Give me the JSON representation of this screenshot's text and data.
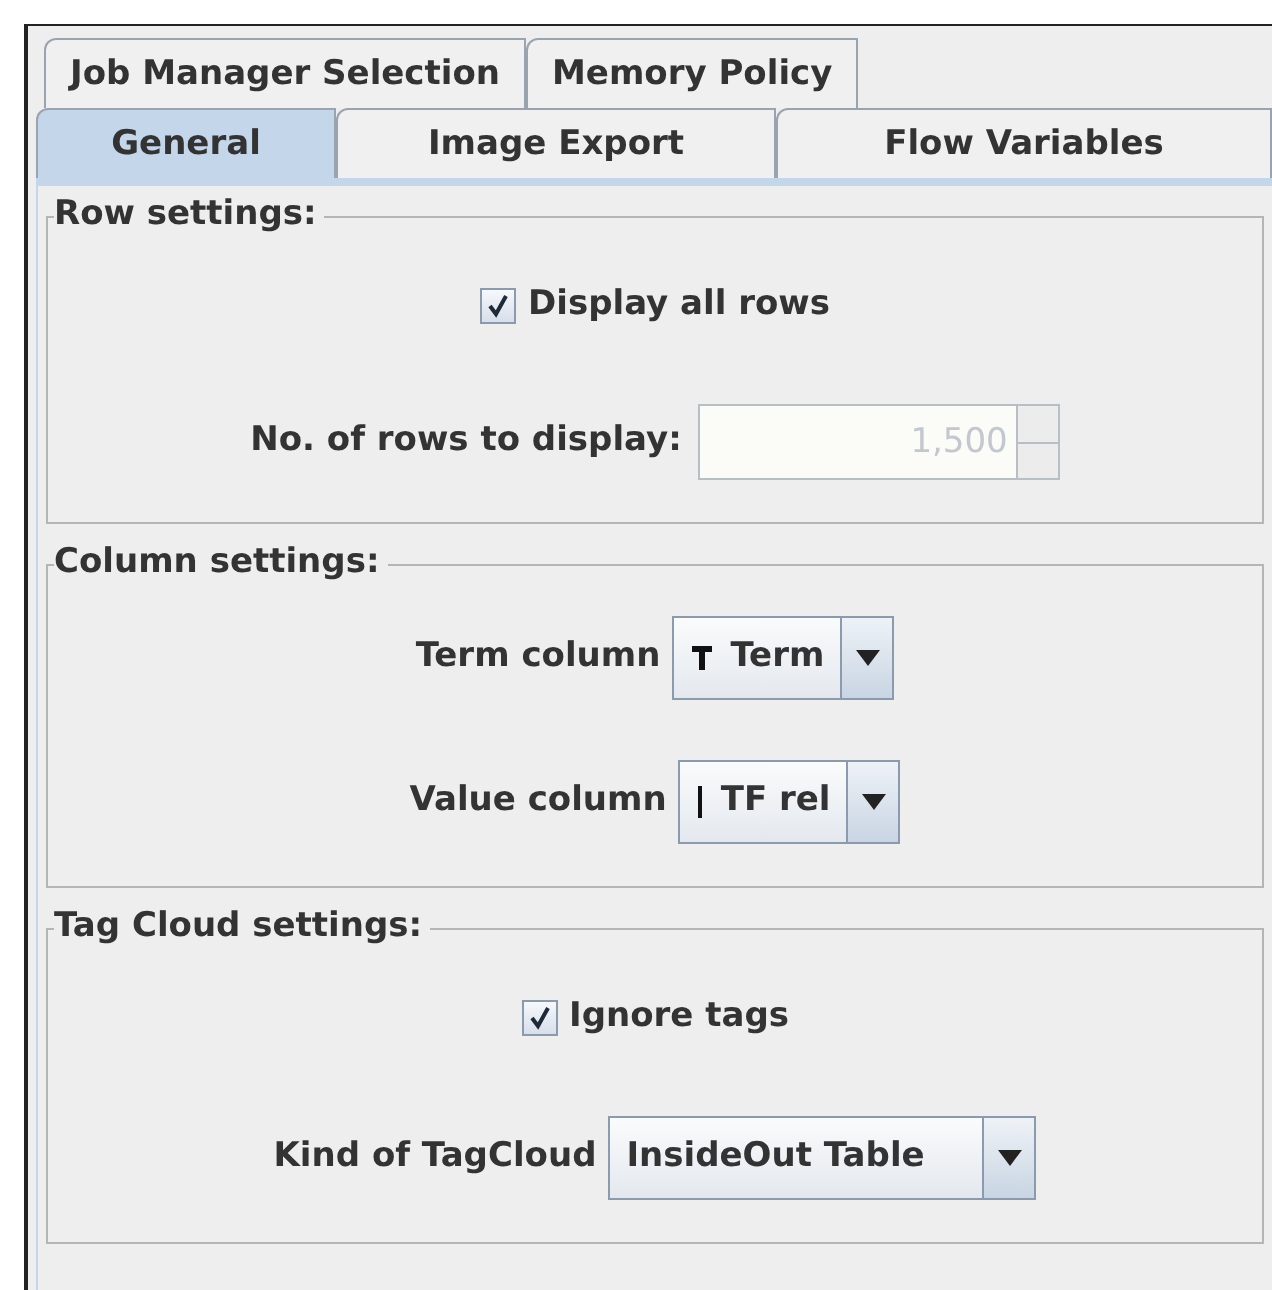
{
  "tab_rows": [
    [
      {
        "label": "Job Manager Selection",
        "selected": false
      },
      {
        "label": "Memory Policy",
        "selected": false
      }
    ],
    [
      {
        "label": "General",
        "selected": true
      },
      {
        "label": "Image Export",
        "selected": false
      },
      {
        "label": "Flow Variables",
        "selected": false
      }
    ]
  ],
  "sections": [
    {
      "title": "Row settings:",
      "rows": [
        {
          "kind": "checkbox",
          "label": "Display all rows",
          "checked": true
        },
        {
          "kind": "spinner",
          "label": "No. of rows to display:",
          "value": "1,500",
          "disabled": true
        }
      ]
    },
    {
      "title": "Column settings:",
      "rows": [
        {
          "kind": "combo",
          "label": "Term column",
          "value": "Term",
          "type_icon": {
            "kind": "string"
          }
        },
        {
          "kind": "combo",
          "label": "Value column",
          "value": "TF rel",
          "type_icon": {
            "kind": "double"
          }
        }
      ]
    },
    {
      "title": "Tag Cloud settings:",
      "rows": [
        {
          "kind": "checkbox",
          "label": "Ignore tags",
          "checked": true
        },
        {
          "kind": "combo",
          "label": "Kind of TagCloud",
          "value": "InsideOut Table"
        }
      ]
    }
  ]
}
